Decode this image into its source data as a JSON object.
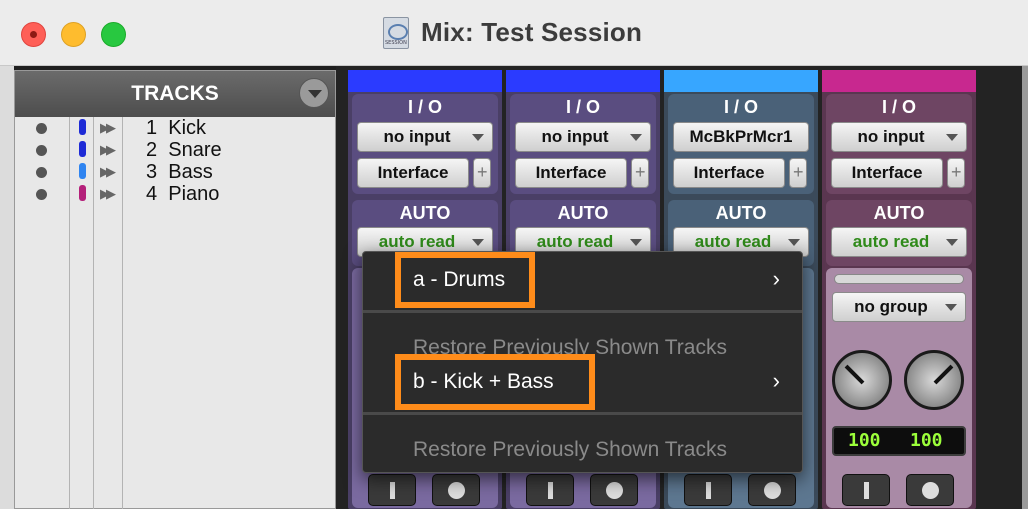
{
  "window": {
    "title": "Mix: Test Session"
  },
  "tracks_panel": {
    "header": "TRACKS",
    "tracks": [
      {
        "number": "1",
        "name": "Kick",
        "color": "#1e2bd6"
      },
      {
        "number": "2",
        "name": "Snare",
        "color": "#1e2bd6"
      },
      {
        "number": "3",
        "name": "Bass",
        "color": "#2f84f0"
      },
      {
        "number": "4",
        "name": "Piano",
        "color": "#b4207a"
      }
    ]
  },
  "strips": [
    {
      "color": "#2b3bff",
      "io_label": "I / O",
      "input": "no input",
      "output": "Interface",
      "auto_label": "AUTO",
      "auto": "auto read"
    },
    {
      "color": "#2b3bff",
      "io_label": "I / O",
      "input": "no input",
      "output": "Interface",
      "auto_label": "AUTO",
      "auto": "auto read"
    },
    {
      "color": "#37a6ff",
      "io_label": "I / O",
      "input": "McBkPrMcr1",
      "output": "Interface",
      "auto_label": "AUTO",
      "auto": "auto read"
    },
    {
      "color": "#c8288f",
      "io_label": "I / O",
      "input": "no input",
      "output": "Interface",
      "auto_label": "AUTO",
      "auto": "auto read",
      "group": "no group",
      "pan_left": "100",
      "pan_right": "100"
    }
  ],
  "menu": {
    "items": [
      {
        "label": "a - Drums",
        "has_submenu": true
      },
      {
        "label": "Restore Previously Shown Tracks",
        "disabled": true
      },
      {
        "label": "b - Kick + Bass",
        "has_submenu": true
      },
      {
        "label": "Restore Previously Shown Tracks",
        "disabled": true
      }
    ],
    "chevron": "›",
    "highlight_color": "#ff8c1a"
  }
}
